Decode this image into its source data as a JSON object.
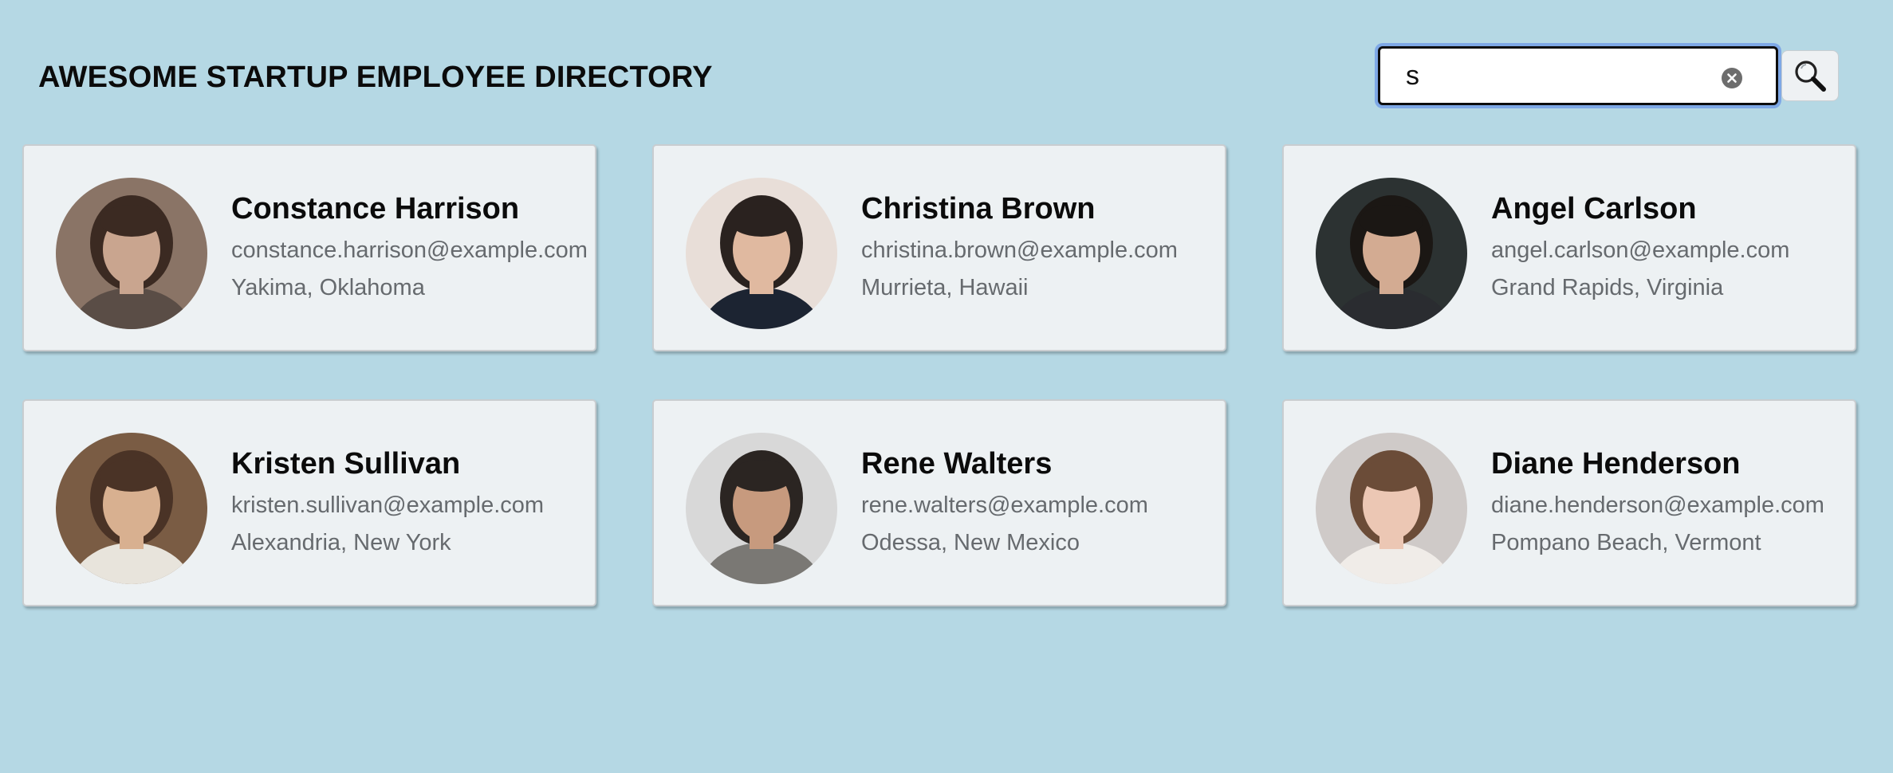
{
  "header": {
    "title": "AWESOME STARTUP EMPLOYEE DIRECTORY"
  },
  "search": {
    "value": "s",
    "clear_icon": "x-circle-icon",
    "button_icon": "search-icon"
  },
  "employees": [
    {
      "name": "Constance Harrison",
      "email": "constance.harrison@example.com",
      "location": "Yakima, Oklahoma",
      "avatar": {
        "skin": "#c9a58f",
        "hair": "#3b2a22",
        "bg": "#8a7466",
        "shirt": "#5a4d46"
      }
    },
    {
      "name": "Christina Brown",
      "email": "christina.brown@example.com",
      "location": "Murrieta, Hawaii",
      "avatar": {
        "skin": "#e0b9a0",
        "hair": "#2a221f",
        "bg": "#e8ded8",
        "shirt": "#1c2432"
      }
    },
    {
      "name": "Angel Carlson",
      "email": "angel.carlson@example.com",
      "location": "Grand Rapids, Virginia",
      "avatar": {
        "skin": "#d3ab92",
        "hair": "#1b1714",
        "bg": "#2c3232",
        "shirt": "#2a2c30"
      }
    },
    {
      "name": "Kristen Sullivan",
      "email": "kristen.sullivan@example.com",
      "location": "Alexandria, New York",
      "avatar": {
        "skin": "#d8b090",
        "hair": "#4a3326",
        "bg": "#7a5c44",
        "shirt": "#e8e4dc"
      }
    },
    {
      "name": "Rene Walters",
      "email": "rene.walters@example.com",
      "location": "Odessa, New Mexico",
      "avatar": {
        "skin": "#c79a7e",
        "hair": "#2b2522",
        "bg": "#d8d8d8",
        "shirt": "#7a7874"
      }
    },
    {
      "name": "Diane Henderson",
      "email": "diane.henderson@example.com",
      "location": "Pompano Beach, Vermont",
      "avatar": {
        "skin": "#ecc7b4",
        "hair": "#6b4c38",
        "bg": "#cfcac8",
        "shirt": "#f0ece8"
      }
    }
  ]
}
